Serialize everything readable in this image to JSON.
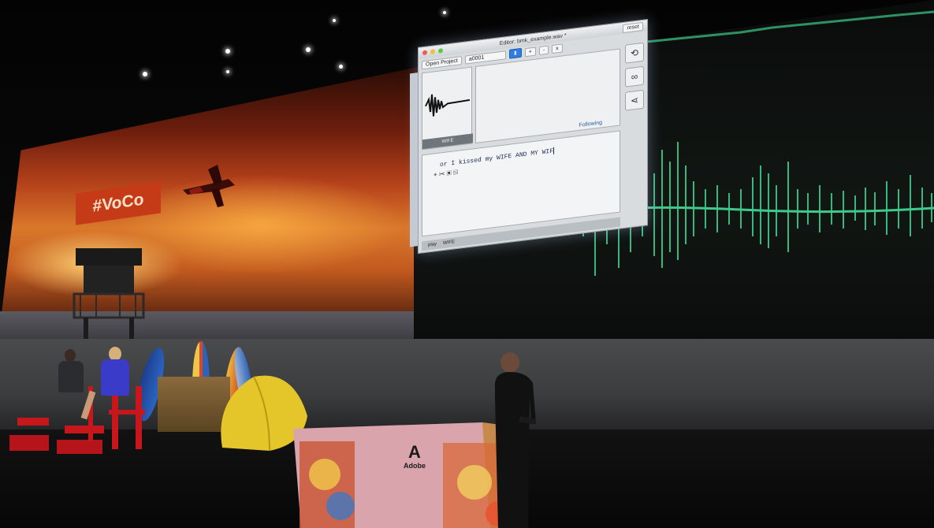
{
  "scene": {
    "banner_text": "#VoCo",
    "adobe_word": "Adobe"
  },
  "app": {
    "title": "Editor: bmk_example.wav *",
    "reset_label": "reset",
    "open_project_label": "Open Project",
    "project_field": "a0001",
    "toolbar_buttons": [
      "+",
      "-",
      "x"
    ],
    "clip_label": "WIFE",
    "following_label": "Following",
    "transcript": "  or I kissed my WIFE AND MY WIF",
    "status_items": [
      "play",
      "WIFE"
    ]
  },
  "colors": {
    "waveform": "#3fc98a",
    "banner": "#c53a17",
    "podium": "#d9a4ab"
  },
  "icons": [
    "replace-icon",
    "glasses-icon",
    "share-icon"
  ]
}
